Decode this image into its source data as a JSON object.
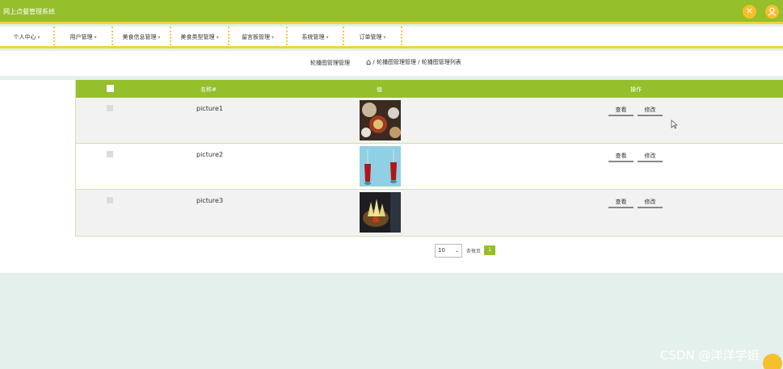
{
  "app": {
    "title": "网上点餐管理系统",
    "icons": [
      "tools-icon",
      "user-icon"
    ]
  },
  "nav": {
    "items": [
      {
        "label": "个人中心"
      },
      {
        "label": "用户管理"
      },
      {
        "label": "美食信息管理"
      },
      {
        "label": "美食类型管理"
      },
      {
        "label": "留言板管理"
      },
      {
        "label": "系统管理"
      },
      {
        "label": "订单管理"
      }
    ]
  },
  "breadcrumb": {
    "title": "轮播图管理管理",
    "path": "/ 轮播图管理管理 / 轮播图管理列表"
  },
  "table": {
    "headers": {
      "name": "名称#",
      "value": "值",
      "actions": "操作"
    },
    "rows": [
      {
        "name": "picture1",
        "view": "查看",
        "edit": "修改"
      },
      {
        "name": "picture2",
        "view": "查看",
        "edit": "修改"
      },
      {
        "name": "picture3",
        "view": "查看",
        "edit": "修改"
      }
    ]
  },
  "pagination": {
    "page_size": "10",
    "per_page_label": "条每页",
    "current_page": "1"
  },
  "watermark": "CSDN @洋洋学姐",
  "colors": {
    "brand": "#95bf2b",
    "accent": "#f5d33a"
  }
}
